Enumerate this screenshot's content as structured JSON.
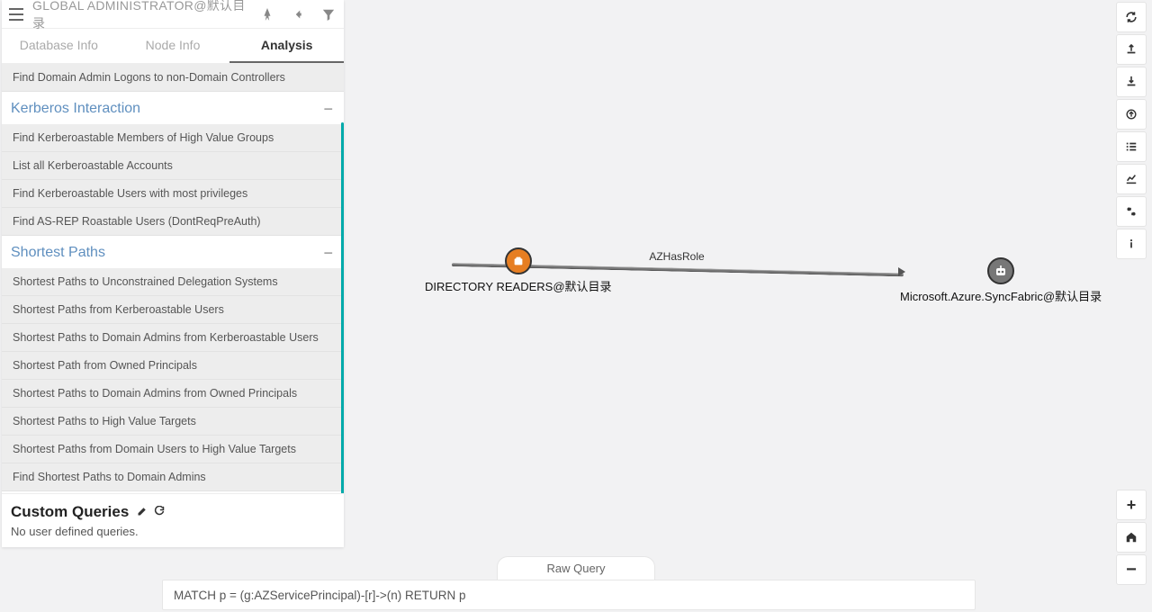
{
  "header": {
    "title": "GLOBAL ADMINISTRATOR@默认目录"
  },
  "tabs": {
    "database_info": "Database Info",
    "node_info": "Node Info",
    "analysis": "Analysis"
  },
  "queries": {
    "orphan_items": [
      "Find Domain Admin Logons to non-Domain Controllers"
    ],
    "kerberos": {
      "title": "Kerberos Interaction",
      "items": [
        "Find Kerberoastable Members of High Value Groups",
        "List all Kerberoastable Accounts",
        "Find Kerberoastable Users with most privileges",
        "Find AS-REP Roastable Users (DontReqPreAuth)"
      ]
    },
    "shortest_paths": {
      "title": "Shortest Paths",
      "items": [
        "Shortest Paths to Unconstrained Delegation Systems",
        "Shortest Paths from Kerberoastable Users",
        "Shortest Paths to Domain Admins from Kerberoastable Users",
        "Shortest Path from Owned Principals",
        "Shortest Paths to Domain Admins from Owned Principals",
        "Shortest Paths to High Value Targets",
        "Shortest Paths from Domain Users to High Value Targets",
        "Find Shortest Paths to Domain Admins"
      ]
    }
  },
  "custom_queries": {
    "title": "Custom Queries",
    "empty": "No user defined queries."
  },
  "graph": {
    "source_label": "DIRECTORY READERS@默认目录",
    "target_label": "Microsoft.Azure.SyncFabric@默认目录",
    "edge_label": "AZHasRole"
  },
  "raw_query": {
    "tab_label": "Raw Query",
    "value": "MATCH p = (g:AZServicePrincipal)-[r]->(n) RETURN p"
  }
}
